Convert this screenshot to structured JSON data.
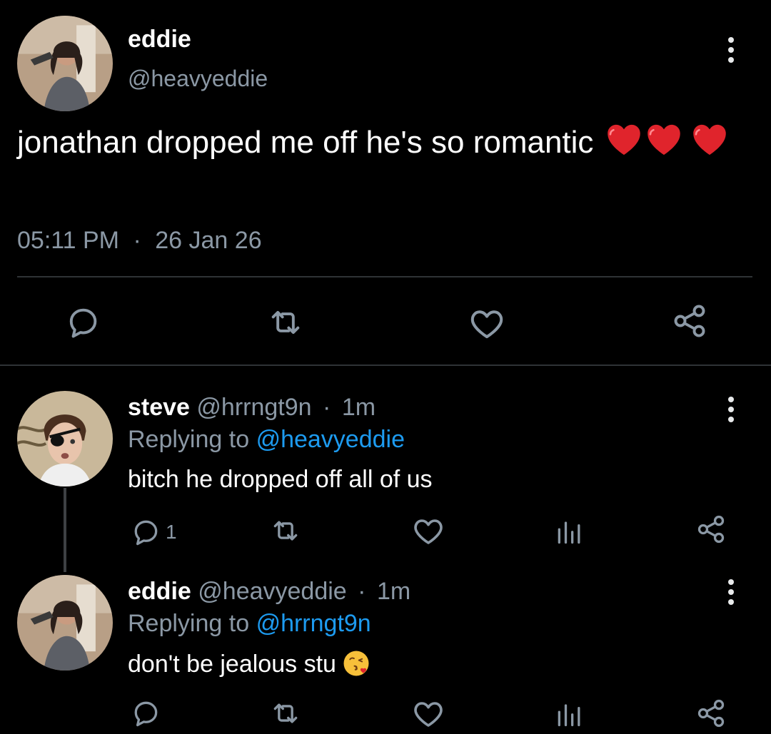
{
  "main_tweet": {
    "author_name": "eddie",
    "author_handle": "@heavyeddie",
    "text": "jonathan dropped me off he's so romantic",
    "emoji_icons": [
      "red-heart-icon",
      "red-heart-icon",
      "red-heart-icon"
    ],
    "time": "05:11 PM",
    "separator": "·",
    "date": "26 Jan 26",
    "actions": [
      "reply-icon",
      "retweet-icon",
      "like-icon",
      "share-icon"
    ]
  },
  "replies": [
    {
      "author_name": "steve",
      "author_handle": "@hrrngt9n",
      "dot": "·",
      "time_ago": "1m",
      "replying_prefix": "Replying to",
      "replying_to": "@heavyeddie",
      "text": "bitch he dropped off all of us",
      "reply_count": "1",
      "actions": [
        "reply-icon",
        "retweet-icon",
        "like-icon",
        "views-icon",
        "share-icon"
      ]
    },
    {
      "author_name": "eddie",
      "author_handle": "@heavyeddie",
      "dot": "·",
      "time_ago": "1m",
      "replying_prefix": "Replying to",
      "replying_to": "@hrrngt9n",
      "text": "don't be jealous stu",
      "emoji_icon": "kissing-face-icon",
      "reply_count": "",
      "actions": [
        "reply-icon",
        "retweet-icon",
        "like-icon",
        "views-icon",
        "share-icon"
      ]
    }
  ],
  "colors": {
    "background": "#000000",
    "text_primary": "#ffffff",
    "text_secondary": "#8b98a5",
    "link": "#1d9bf0",
    "divider": "#2f3336"
  }
}
